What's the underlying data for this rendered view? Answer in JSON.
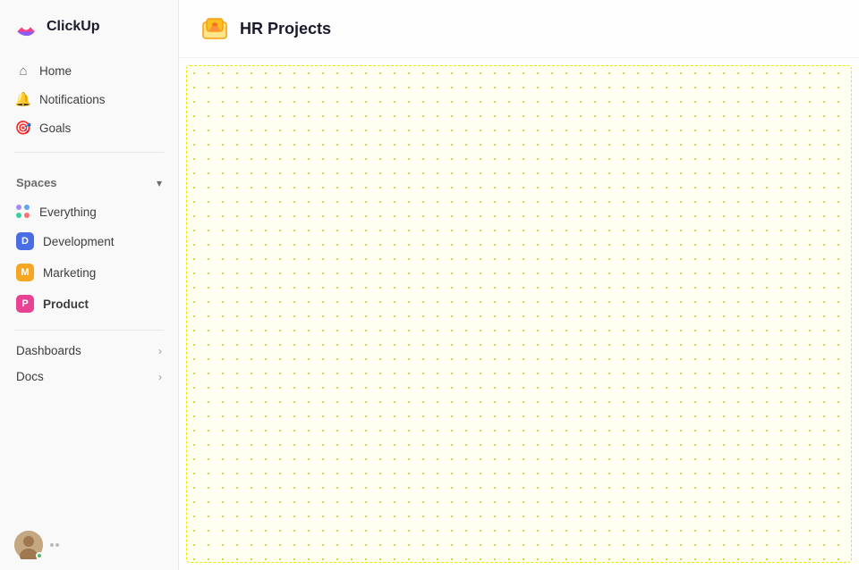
{
  "logo": {
    "text": "ClickUp"
  },
  "nav": {
    "home_label": "Home",
    "notifications_label": "Notifications",
    "goals_label": "Goals"
  },
  "spaces": {
    "label": "Spaces",
    "items": [
      {
        "id": "everything",
        "label": "Everything",
        "type": "dots",
        "active": false
      },
      {
        "id": "development",
        "label": "Development",
        "type": "avatar",
        "color": "#4a6de5",
        "letter": "D",
        "active": false
      },
      {
        "id": "marketing",
        "label": "Marketing",
        "type": "avatar",
        "color": "#f5a623",
        "letter": "M",
        "active": false
      },
      {
        "id": "product",
        "label": "Product",
        "type": "avatar",
        "color": "#e84393",
        "letter": "P",
        "active": true
      }
    ]
  },
  "expandable": {
    "dashboards_label": "Dashboards",
    "docs_label": "Docs"
  },
  "header": {
    "title": "HR Projects"
  },
  "canvas": {
    "dotted": true
  }
}
